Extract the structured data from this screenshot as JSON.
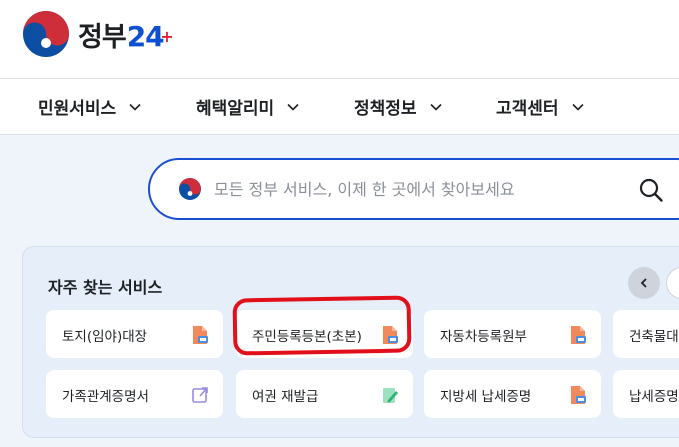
{
  "logo": {
    "text": "정부",
    "num": "24",
    "plus": "+"
  },
  "nav": [
    {
      "label": "민원서비스"
    },
    {
      "label": "혜택알리미"
    },
    {
      "label": "정책정보"
    },
    {
      "label": "고객센터"
    }
  ],
  "search": {
    "placeholder": "모든 정부 서비스, 이제 한 곳에서 찾아보세요"
  },
  "favorites": {
    "title": "자주 찾는 서비스",
    "cards": [
      {
        "label": "토지(임야)대장",
        "icon": "pdf-doc-icon"
      },
      {
        "label": "주민등록등본(초본)",
        "icon": "pdf-doc-icon"
      },
      {
        "label": "자동차등록원부",
        "icon": "pdf-doc-icon"
      },
      {
        "label": "건축물대",
        "icon": ""
      },
      {
        "label": "가족관계증명서",
        "icon": "external-link-icon"
      },
      {
        "label": "여권 재발급",
        "icon": "edit-doc-icon"
      },
      {
        "label": "지방세 납세증명",
        "icon": "pdf-doc-icon"
      },
      {
        "label": "납세증명",
        "icon": ""
      }
    ]
  },
  "colors": {
    "accent": "#1b4fd1",
    "highlight": "#e2101a",
    "panel": "#e6eefa"
  }
}
